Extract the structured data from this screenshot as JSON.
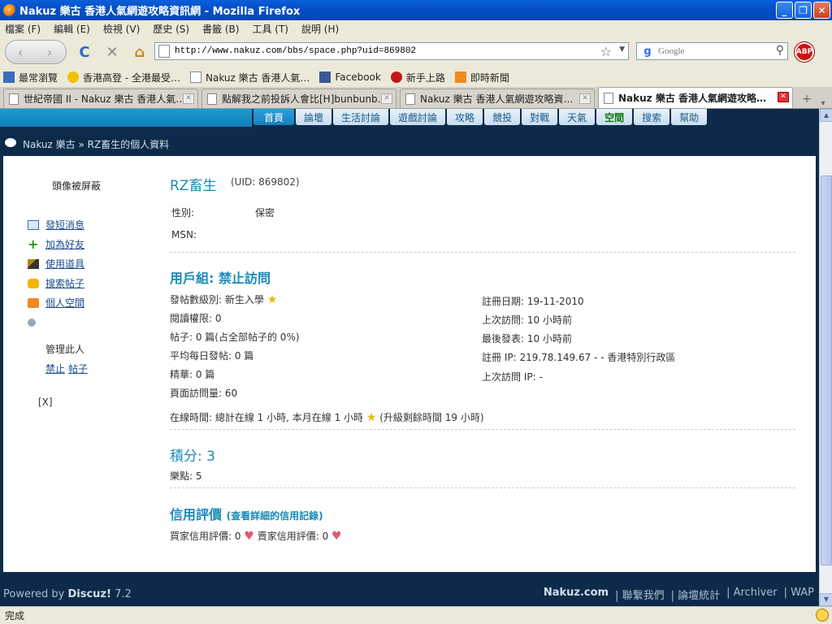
{
  "window": {
    "title": "Nakuz 樂古 香港人氣網遊攻略資訊網 - Mozilla Firefox",
    "btn_min": "_",
    "btn_max": "❐",
    "btn_close": "✕"
  },
  "menu": [
    "檔案 (F)",
    "編輯 (E)",
    "檢視 (V)",
    "歷史 (S)",
    "書籤 (B)",
    "工具 (T)",
    "說明 (H)"
  ],
  "nav": {
    "back_glyph": "‹",
    "forward_glyph": "›",
    "reload_glyph": "C",
    "stop_glyph": "✕",
    "home_glyph": "⌂",
    "url": "http://www.nakuz.com/bbs/space.php?uid=869802",
    "search_engine": "g",
    "search_placeholder": "Google",
    "abp": "ABP"
  },
  "bookmarks": [
    "最常瀏覽",
    "香港高登 - 全港最受…",
    "Nakuz 樂古 香港人氣…",
    "Facebook",
    "新手上路",
    "即時新聞"
  ],
  "tabs": [
    {
      "label": "世紀帝國 II - Nakuz 樂古 香港人氣…",
      "active": false
    },
    {
      "label": "點解我之前投訴人會比[H]bunbunb…",
      "active": false
    },
    {
      "label": "Nakuz 樂古 香港人氣網遊攻略資…",
      "active": false
    },
    {
      "label": "Nakuz 樂古 香港人氣網遊攻略…",
      "active": true
    }
  ],
  "tab_new": "+",
  "tab_list": "▾",
  "sitenav": [
    "首頁",
    "論壇",
    "生活討論",
    "遊戲討論",
    "攻略",
    "競投",
    "對戰",
    "天氣",
    "空間",
    "搜索",
    "幫助"
  ],
  "breadcrumb": "Nakuz 樂古 » RZ畜生的個人資料",
  "sidebar": {
    "avatar_note": "頭像被屏蔽",
    "links": [
      "發短消息",
      "加為好友",
      "使用道具",
      "搜索帖子",
      "個人空間"
    ],
    "manage_label": "管理此人",
    "ban": "禁止",
    "posts": "帖子",
    "close": "[X]"
  },
  "profile": {
    "username": "RZ畜生",
    "uid": "(UID: 869802)",
    "gender_label": "性別:",
    "gender_value": "保密",
    "msn_label": "MSN:",
    "group_heading": "用戶組: 禁止訪問",
    "left": [
      "發帖數級別: 新生入學",
      "閱讀權限: 0",
      "帖子: 0 篇(占全部帖子的 0%)",
      "平均每日發帖: 0 篇",
      "精華: 0 篇",
      "頁面訪問量: 60"
    ],
    "right": [
      "註冊日期: 19-11-2010",
      "上次訪問: 10 小時前",
      "最後發表: 10 小時前",
      "註冊 IP: 219.78.149.67 - - 香港特別行政區",
      "上次訪問 IP: -"
    ],
    "online": "在線時間: 總計在線 1 小時, 本月在線 1 小時",
    "online_upgrade": "(升級剩餘時間 19 小時)",
    "credits_heading": "積分: 3",
    "music_points": "樂點: 5",
    "trust_heading": "信用評價",
    "trust_link": "(查看詳細的信用記錄)",
    "buyer": "買家信用評價: 0",
    "seller": "賣家信用評價: 0"
  },
  "footer": {
    "powered": "Powered by ",
    "brand": "Discuz!",
    "version": " 7.2",
    "links": [
      "Nakuz.com",
      "| 聯繫我們",
      "| 論壇統計",
      "| Archiver",
      "| WAP"
    ]
  },
  "status": "完成"
}
